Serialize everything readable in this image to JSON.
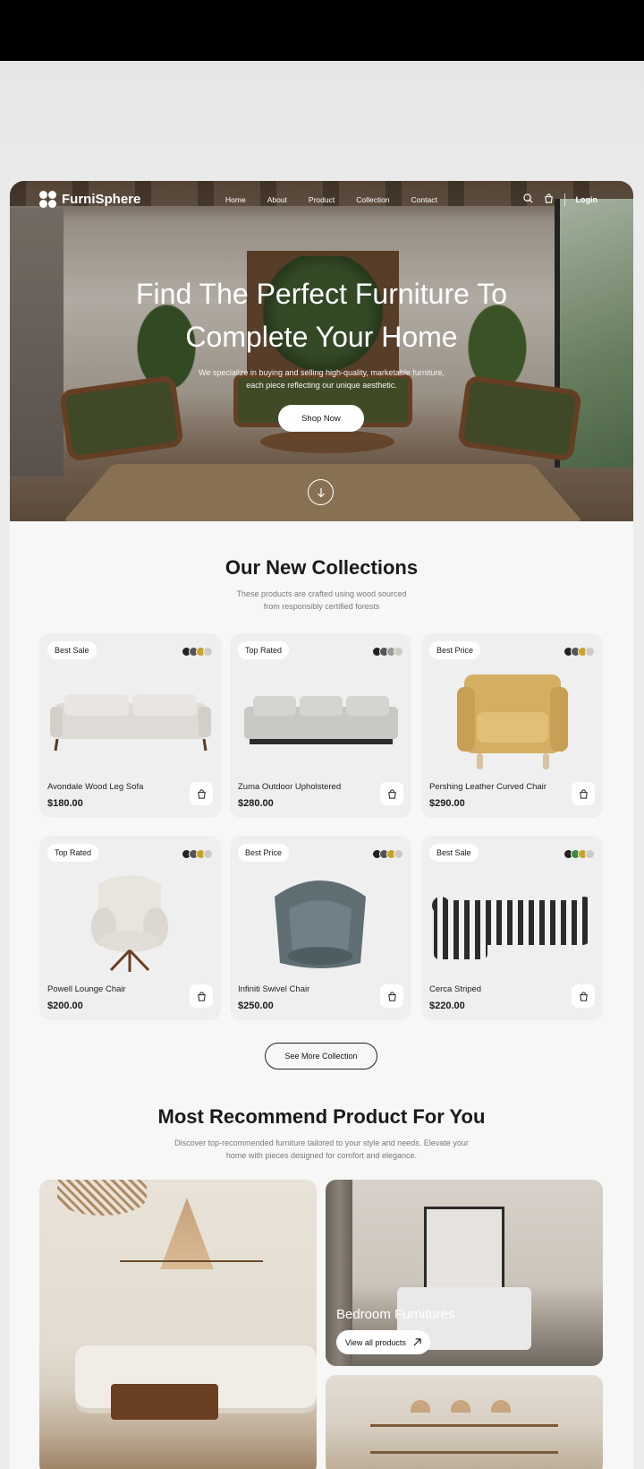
{
  "brand": {
    "name": "FurniSphere"
  },
  "nav": {
    "links": [
      "Home",
      "About",
      "Product",
      "Collection",
      "Contact"
    ],
    "login": "Login"
  },
  "hero": {
    "title_line1": "Find The Perfect Furniture To",
    "title_line2": "Complete Your Home",
    "subtitle_line1": "We specialize in buying and selling high-quality, marketable furniture,",
    "subtitle_line2": "each piece reflecting our unique aesthetic.",
    "cta": "Shop Now"
  },
  "collections": {
    "title": "Our New Collections",
    "subtitle_line1": "These products are crafted using wood sourced",
    "subtitle_line2": "from responsibly certified forests",
    "products": [
      {
        "badge": "Best Sale",
        "name": "Avondale Wood Leg Sofa",
        "price": "$180.00",
        "swatches": [
          "#222222",
          "#555555",
          "#c9a227",
          "#cfcac3"
        ]
      },
      {
        "badge": "Top Rated",
        "name": "Zuma Outdoor Upholstered",
        "price": "$280.00",
        "swatches": [
          "#222222",
          "#555555",
          "#9a9a9a",
          "#cfcac3"
        ]
      },
      {
        "badge": "Best Price",
        "name": "Pershing Leather Curved Chair",
        "price": "$290.00",
        "swatches": [
          "#222222",
          "#555555",
          "#c9a227",
          "#cfcac3"
        ]
      },
      {
        "badge": "Top Rated",
        "name": "Powell Lounge Chair",
        "price": "$200.00",
        "swatches": [
          "#222222",
          "#555555",
          "#c9a227",
          "#cfcac3"
        ]
      },
      {
        "badge": "Best Price",
        "name": "Infiniti Swivel Chair",
        "price": "$250.00",
        "swatches": [
          "#222222",
          "#555555",
          "#c9a227",
          "#cfcac3"
        ]
      },
      {
        "badge": "Best Sale",
        "name": "Cerca Striped",
        "price": "$220.00",
        "swatches": [
          "#222222",
          "#3d8a3a",
          "#c9a227",
          "#cfcac3"
        ]
      }
    ],
    "more": "See More Collection"
  },
  "recommend": {
    "title": "Most Recommend Product For You",
    "subtitle_line1": "Discover top-recommended furniture tailored to your style and needs. Elevate your",
    "subtitle_line2": "home with pieces designed for comfort and elegance.",
    "bedroom_label": "Bedroom Furnitures",
    "view_all": "View all products"
  }
}
